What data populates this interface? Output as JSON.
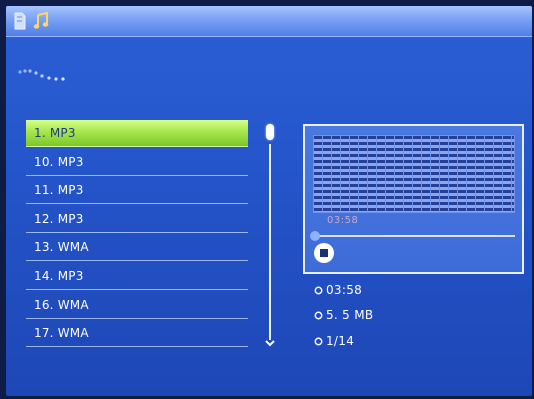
{
  "screen": {
    "title_icons": [
      "memory-card-icon",
      "music-note-icon"
    ]
  },
  "playlist": {
    "items": [
      {
        "label": "1. MP3",
        "selected": true
      },
      {
        "label": "10. MP3",
        "selected": false
      },
      {
        "label": "11. MP3",
        "selected": false
      },
      {
        "label": "12. MP3",
        "selected": false
      },
      {
        "label": "13. WMA",
        "selected": false
      },
      {
        "label": "14. MP3",
        "selected": false
      },
      {
        "label": "16. WMA",
        "selected": false
      },
      {
        "label": "17. WMA",
        "selected": false
      }
    ]
  },
  "player": {
    "elapsed_time": "03:58",
    "progress_fraction": 0.0,
    "visualizer_icon": "equalizer-bars-icon",
    "stop_icon": "stop-icon"
  },
  "info": {
    "duration": "03:58",
    "file_size": "5. 5 MB",
    "track_index": "1/14"
  },
  "colors": {
    "background": "#2454c9",
    "selection": "#a8e64d",
    "text": "#ffffff"
  }
}
